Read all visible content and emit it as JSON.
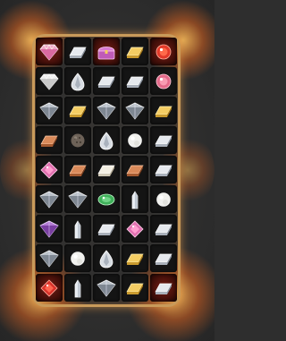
{
  "game": {
    "title": "",
    "rows": 9,
    "cols": 5,
    "board": [
      [
        "pink-diamond-gem",
        "silver-bar-gem",
        "treasure-chest",
        "gold-bar-gem",
        "red-round-gem"
      ],
      [
        "white-diamond-gem",
        "silver-teardrop-gem",
        "silver-bar-gem",
        "silver-bar-gem",
        "pink-round-gem"
      ],
      [
        "silver-diamond-gem",
        "gold-bar-gem",
        "silver-diamond-gem",
        "silver-diamond-gem",
        "gold-bar-gem"
      ],
      [
        "copper-bar-gem",
        "stone-sphere-gem",
        "silver-teardrop-gem",
        "pearl-gem",
        "silver-bar-gem"
      ],
      [
        "pink-square-gem",
        "copper-bar-gem",
        "pearl-bar-gem",
        "copper-bar-gem",
        "silver-bar-gem"
      ],
      [
        "silver-diamond-gem",
        "silver-diamond-gem",
        "emerald-oval-gem",
        "quartz-crystal-gem",
        "pearl-gem"
      ],
      [
        "purple-diamond-gem",
        "quartz-crystal-gem",
        "silver-bar-gem",
        "pink-square-gem",
        "silver-bar-gem"
      ],
      [
        "silver-diamond-gem",
        "pearl-gem",
        "silver-teardrop-gem",
        "gold-bar-gem",
        "silver-bar-gem"
      ],
      [
        "red-square-gem",
        "quartz-crystal-gem",
        "silver-diamond-gem",
        "gold-bar-gem",
        "silver-bar-gem"
      ]
    ],
    "highlighted_cells": [
      [
        0,
        0
      ],
      [
        0,
        2
      ],
      [
        0,
        4
      ],
      [
        8,
        0
      ],
      [
        8,
        4
      ]
    ],
    "colors": {
      "frame": "#c89a5a",
      "glow": "#ff8a2a",
      "cell": "#141414"
    }
  }
}
